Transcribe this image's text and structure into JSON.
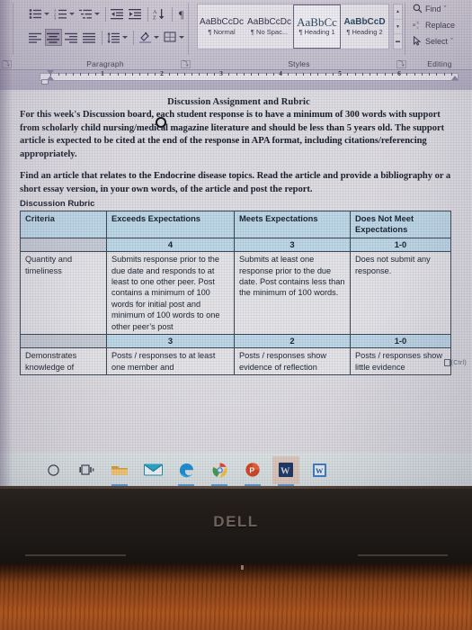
{
  "app": {
    "name": "Microsoft Word",
    "ribbon": {
      "groups": [
        {
          "name": "Paragraph",
          "label": "Paragraph"
        },
        {
          "name": "Styles",
          "label": "Styles"
        },
        {
          "name": "Editing",
          "label": "Editing"
        }
      ],
      "paragraph": {
        "buttons_row1": [
          "bullets-icon",
          "bullets-dropdown",
          "numbering-icon",
          "numbering-dropdown",
          "multilevel-list-icon",
          "multilevel-dropdown",
          "decrease-indent-icon",
          "increase-indent-icon",
          "sort-icon",
          "show-formatting-marks-icon"
        ],
        "buttons_row2": [
          "align-left-icon",
          "align-center-icon",
          "align-right-icon",
          "justify-icon",
          "line-spacing-icon",
          "line-spacing-dropdown",
          "shading-icon",
          "shading-dropdown",
          "borders-icon",
          "borders-dropdown"
        ]
      },
      "styles": {
        "items": [
          {
            "sample": "AaBbCcDc",
            "name": "Normal",
            "active": false
          },
          {
            "sample": "AaBbCcDc",
            "name": "No Spac...",
            "active": false
          },
          {
            "sample": "AaBbCc",
            "name": "Heading 1",
            "active": true
          },
          {
            "sample": "AaBbCcD",
            "name": "Heading 2",
            "active": false
          }
        ],
        "pilcrow": "¶",
        "scroll_up": "▲",
        "scroll_down": "▼",
        "more": "▬"
      },
      "editing": {
        "find": "Find",
        "replace": "Replace",
        "select": "Select",
        "find_icon": "magnifier-icon",
        "replace_icon": "replace-abc-icon",
        "select_icon": "pointer-icon",
        "dropdown_caret": "ˇ"
      },
      "dialog_launcher": "⤵"
    },
    "ruler": {
      "numbers": [
        "1",
        "2",
        "3",
        "4",
        "5",
        "6"
      ],
      "unit": "inches"
    }
  },
  "document": {
    "title": "Discussion Assignment and Rubric",
    "paragraph1": "For this week's Discussion board, each student response is to have a minimum of 300 words with support from scholarly child nursing/medical magazine literature and should be less than 5 years old.  The support article is expected to be cited at the end of the response in APA format, including citations/referencing appropriately.",
    "paragraph2": "Find an article that relates to the Endocrine disease topics.  Read the article and provide a bibliography or a short essay version, in your own words, of the article and post the report.",
    "rubric_label": "Discussion Rubric",
    "table": {
      "headers": [
        "Criteria",
        "Exceeds Expectations",
        "Meets Expectations",
        "Does Not Meet Expectations"
      ],
      "rows": [
        {
          "scores": [
            "",
            "4",
            "3",
            "1-0"
          ],
          "cells": [
            "Quantity and timeliness",
            "Submits response prior to the due date and responds to at least to one other peer. Post contains a minimum of 100 words for initial post and minimum of 100 words to one other peer’s post",
            "Submits at least one response prior to the due date. Post contains less than the minimum of 100 words.",
            "Does not submit any response."
          ]
        },
        {
          "scores": [
            "",
            "3",
            "2",
            "1-0"
          ],
          "cells": [
            "Demonstrates knowledge of",
            "Posts / responses to at least one member and",
            "Posts / responses show evidence of reflection",
            "Posts / responses show little evidence"
          ]
        }
      ]
    },
    "paste_options_label": "(Ctrl)"
  },
  "taskbar": {
    "items": [
      {
        "name": "cortana-icon",
        "label": "Cortana",
        "active": false
      },
      {
        "name": "task-view-icon",
        "label": "Task View",
        "active": false
      },
      {
        "name": "file-explorer-icon",
        "label": "File Explorer",
        "active": false
      },
      {
        "name": "mail-icon",
        "label": "Mail",
        "active": false
      },
      {
        "name": "edge-icon",
        "label": "Microsoft Edge",
        "active": false
      },
      {
        "name": "chrome-icon",
        "label": "Google Chrome",
        "active": false
      },
      {
        "name": "powerpoint-icon",
        "label": "PowerPoint",
        "active": false
      },
      {
        "name": "word-icon-active",
        "label": "Word",
        "active": true
      },
      {
        "name": "word-icon-second",
        "label": "Word",
        "active": false
      }
    ]
  },
  "hardware": {
    "brand": "DELL",
    "brand_mark": "™"
  },
  "colors": {
    "table_header_bg": "#bdd7e6",
    "table_body_bg": "#e4e3e6",
    "ribbon_bg": "#c9c4d0",
    "taskbar_bg": "#dfe6e6",
    "desk": "#8a4114",
    "bezel": "#221d1a",
    "accent_blue": "#4a8fd0"
  }
}
